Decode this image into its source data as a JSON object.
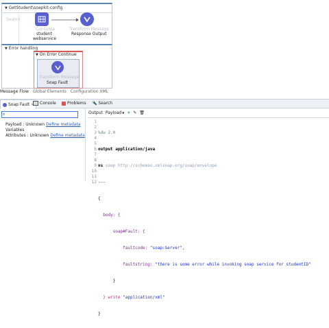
{
  "flow": {
    "title": "GetStudent\\soapkit-config",
    "source_label": "Source",
    "consume_type": "Consume",
    "consume_name_line1": "student",
    "consume_name_line2": "webservice",
    "transform_type": "Transform Message",
    "transform_name": "Response Output"
  },
  "error": {
    "title": "Error handling",
    "scope_title": "On Error Continue",
    "transform_type": "Transform Message",
    "transform_name": "Soap Fault"
  },
  "view_tabs": [
    "Message Flow",
    "Global Elements",
    "Configuration XML"
  ],
  "panel_tabs": {
    "soap_fault": "Soap Fault",
    "console": "Console",
    "problems": "Problems",
    "search": "Search"
  },
  "left": {
    "search_value": "",
    "payload_label": "Payload : Unknown",
    "payload_link": "Define metadata",
    "variables": "Variables",
    "attributes_label": "Attributes : Unknown",
    "attributes_link": "Define metadata"
  },
  "right": {
    "output_label": "Output",
    "payload_select": "Payload",
    "line_numbers": [
      "1",
      "2",
      "3",
      "4",
      "5",
      "6",
      "7",
      "8",
      "9",
      "10",
      "11",
      "12"
    ],
    "code": {
      "l1": "%dw 2.0",
      "l2": "output application/java",
      "l3_ns": "ns",
      "l3_prefix": "soap",
      "l3_url": "http://schemas.xmlsoap.org/soap/envelope",
      "l4": "---",
      "l5": "{",
      "l6": "body: {",
      "l7": "soap#Fault: {",
      "l8_key": "faultcode:",
      "l8_val": "\"soap:Server\",",
      "l9_key": "faultstring:",
      "l9_val": "\"there is some error while invoking soap service for studentID\"",
      "l10": "}",
      "l11_pre": "} write ",
      "l11_str": "\"application/xml\"",
      "l12": "}"
    }
  },
  "colors": {
    "node_purple": "#5a5fd0",
    "link_blue": "#2a5db0",
    "accent_blue": "#3b7dd8",
    "error_red": "#d55555"
  }
}
